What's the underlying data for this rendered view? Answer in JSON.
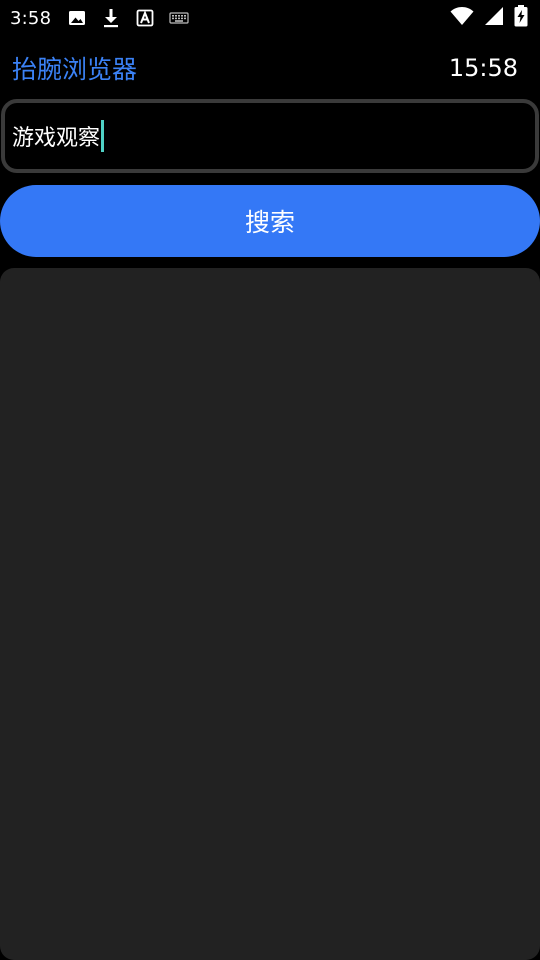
{
  "status_bar": {
    "time": "3:58",
    "icons_left": [
      "image-icon",
      "download-icon",
      "font-a-icon",
      "keyboard-icon"
    ],
    "icons_right": [
      "wifi-icon",
      "signal-icon",
      "battery-charging-icon"
    ]
  },
  "header": {
    "app_title": "抬腕浏览器",
    "clock": "15:58"
  },
  "search": {
    "value": "游戏观察",
    "button_label": "搜索"
  },
  "colors": {
    "accent": "#3b82f6",
    "button": "#3478f6",
    "panel": "#222222",
    "border": "#3a3a3a",
    "caret": "#4fd1c5"
  }
}
